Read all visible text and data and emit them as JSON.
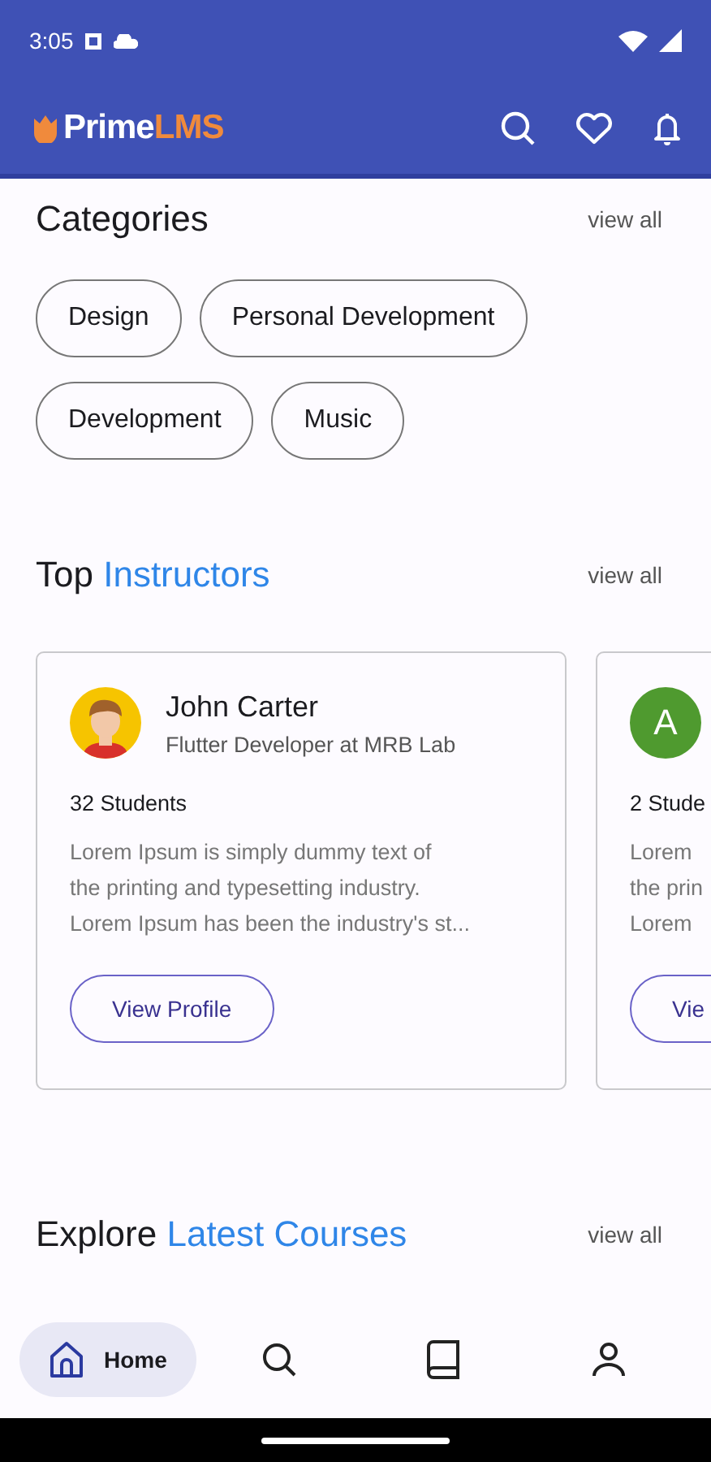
{
  "status_bar": {
    "time": "3:05"
  },
  "app_bar": {
    "logo": {
      "primary": "Prime",
      "accent": "LMS"
    },
    "actions": [
      {
        "kind": "search"
      },
      {
        "kind": "heart"
      },
      {
        "kind": "bell"
      }
    ]
  },
  "categories": {
    "title": "Categories",
    "view_all": "view all",
    "chips": [
      "Design",
      "Personal Development",
      "Development",
      "Music"
    ]
  },
  "instructors": {
    "title": "Top",
    "title_accent": "Instructors",
    "view_all": "view all",
    "cards": [
      {
        "avatar": {
          "kind": "illustration"
        },
        "name": "John Carter",
        "role": "Flutter Developer at MRB Lab",
        "students": "32 Students",
        "bio": [
          "Lorem Ipsum is simply dummy text of",
          "the printing and typesetting industry.",
          "Lorem Ipsum has been the industry's st..."
        ],
        "button": "View Profile"
      },
      {
        "avatar": {
          "kind": "letter",
          "letter": "A",
          "color": "#4f9a2f"
        },
        "students": "2 Stude",
        "bio": [
          "Lorem",
          "the prin",
          "Lorem"
        ],
        "button": "Vie"
      }
    ]
  },
  "courses": {
    "title": "Explore",
    "title_accent": "Latest Courses",
    "view_all": "view all"
  },
  "bottom_nav": [
    {
      "kind": "home",
      "label": "Home",
      "selected": true
    },
    {
      "kind": "search",
      "selected": false
    },
    {
      "kind": "book",
      "selected": false
    },
    {
      "kind": "person",
      "selected": false
    }
  ]
}
